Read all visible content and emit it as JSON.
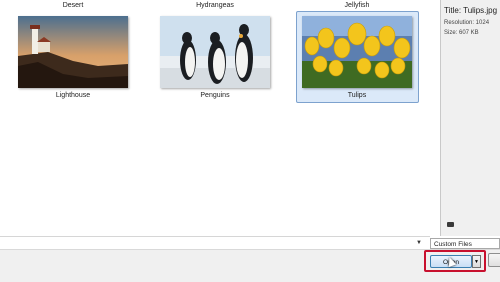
{
  "files": {
    "row1": [
      {
        "name": "Desert"
      },
      {
        "name": "Hydrangeas"
      },
      {
        "name": "Jellyfish"
      }
    ],
    "row2": [
      {
        "name": "Lighthouse"
      },
      {
        "name": "Penguins"
      },
      {
        "name": "Tulips",
        "selected": true
      }
    ]
  },
  "preview": {
    "title": "Title: Tulips.jpg",
    "resolution": "Resolution: 1024",
    "size": "Size: 607 KB"
  },
  "filetype": {
    "value": "Custom Files"
  },
  "buttons": {
    "open_label": "Open"
  },
  "colors": {
    "highlight": "#c8102e",
    "selection": "#dbe9f9"
  }
}
